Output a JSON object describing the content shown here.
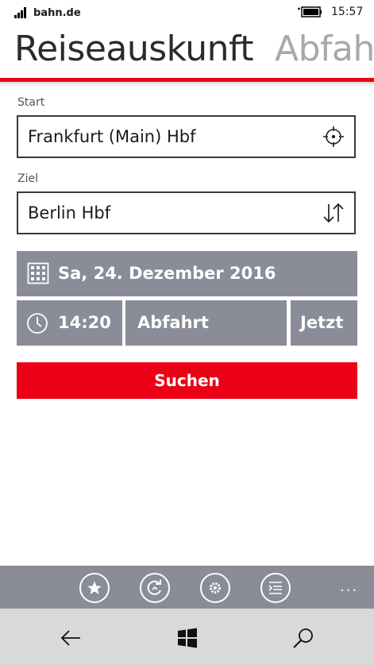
{
  "status": {
    "carrier": "bahn.de",
    "time": "15:57"
  },
  "pivot": {
    "active": "Reiseauskunft",
    "next": "Abfahrt"
  },
  "form": {
    "start_label": "Start",
    "start_value": "Frankfurt (Main) Hbf",
    "ziel_label": "Ziel",
    "ziel_value": "Berlin Hbf",
    "date": "Sa, 24. Dezember 2016",
    "time": "14:20",
    "mode": "Abfahrt",
    "now": "Jetzt",
    "search_label": "Suchen"
  },
  "appbar": {
    "buttons": [
      "star-icon",
      "refresh-icon",
      "settings-icon",
      "list-icon"
    ],
    "more": "..."
  },
  "navbar": {
    "buttons": [
      "back-icon",
      "windows-icon",
      "search-icon"
    ]
  },
  "colors": {
    "accent": "#ec0016",
    "panel": "#8a8c97",
    "nav": "#d9d9d9"
  }
}
